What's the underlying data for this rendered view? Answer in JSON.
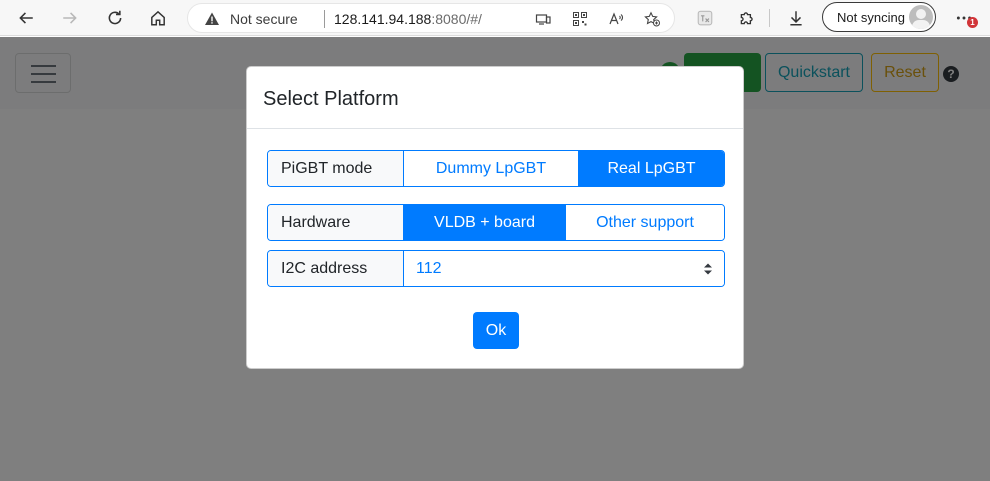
{
  "browser": {
    "security_label": "Not secure",
    "url_host": "128.141.94.188",
    "url_rest": ":8080/#/",
    "sync_label": "Not syncing",
    "notification_count": "1"
  },
  "navbar": {
    "quickstart_label": "Quickstart",
    "reset_label": "Reset",
    "help_label": "?"
  },
  "modal": {
    "title": "Select Platform",
    "mode_group": {
      "label": "PiGBT mode",
      "options": [
        "Dummy LpGBT",
        "Real LpGBT"
      ],
      "selected": "Real LpGBT"
    },
    "hardware_group": {
      "label": "Hardware",
      "options": [
        "VLDB + board",
        "Other support"
      ],
      "selected": "VLDB + board"
    },
    "i2c_group": {
      "label": "I2C address",
      "value": "112"
    },
    "ok_label": "Ok"
  },
  "colors": {
    "primary": "#007bff",
    "success": "#28a745",
    "info": "#17a2b8",
    "warning": "#ffc107"
  }
}
